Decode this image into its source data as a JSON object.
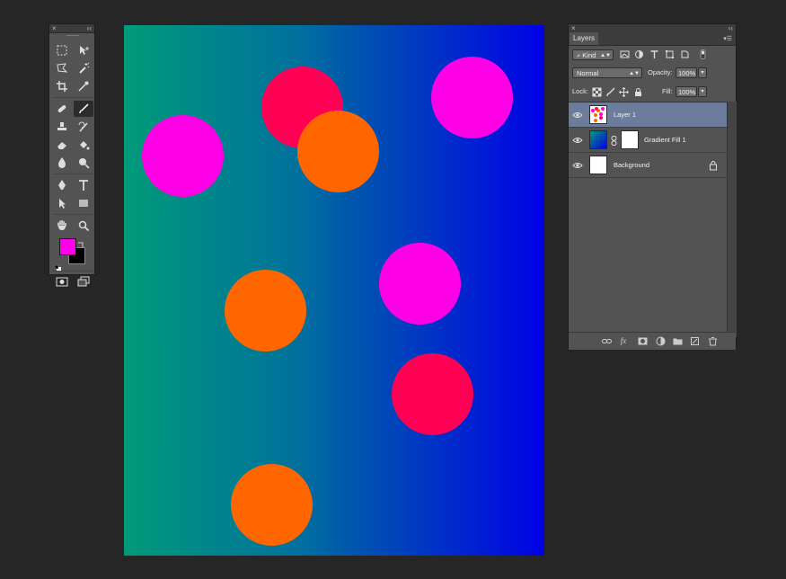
{
  "tools_panel": {
    "close_glyph": "×",
    "collapse_glyph": "‹‹",
    "foreground_color": "#ff00ea",
    "background_color": "#000000"
  },
  "canvas": {
    "gradient": [
      "#009a78",
      "#00729c",
      "#0000e6"
    ],
    "colors": {
      "pink": "#ff0055",
      "orange": "#ff6600",
      "magenta": "#ff00e6"
    }
  },
  "layers_panel": {
    "close_glyph": "×",
    "collapse_glyph": "‹‹",
    "tab_label": "Layers",
    "filter_kind": "Kind",
    "blend_mode": "Normal",
    "opacity_label": "Opacity:",
    "opacity_value": "100%",
    "lock_label": "Lock:",
    "fill_label": "Fill:",
    "fill_value": "100%",
    "layers": [
      {
        "name": "Layer 1",
        "selected": true
      },
      {
        "name": "Gradient Fill 1",
        "selected": false
      },
      {
        "name": "Background",
        "selected": false,
        "locked": true
      }
    ],
    "fx_label": "fx"
  }
}
